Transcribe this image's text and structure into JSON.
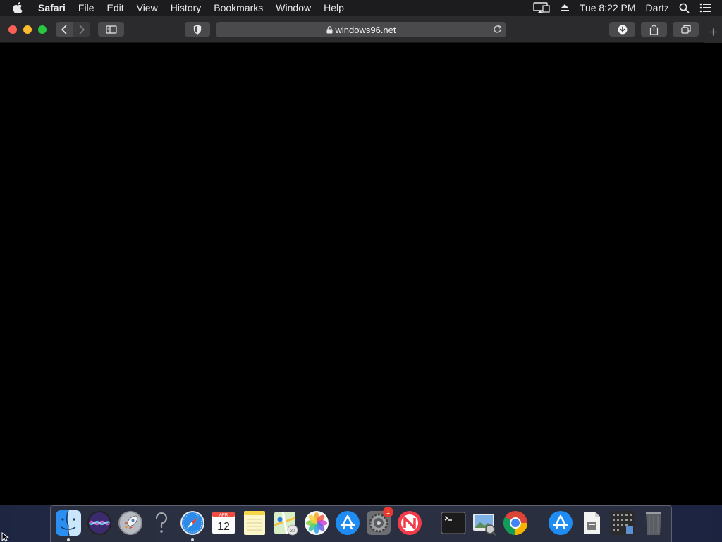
{
  "menubar": {
    "app_name": "Safari",
    "items": [
      "File",
      "Edit",
      "View",
      "History",
      "Bookmarks",
      "Window",
      "Help"
    ],
    "clock": "Tue 8:22 PM",
    "user": "Dartz"
  },
  "toolbar": {
    "url": "windows96.net"
  },
  "dock": {
    "apps": [
      "Finder",
      "Siri",
      "Launchpad",
      "Help",
      "Safari",
      "Calendar",
      "Notes",
      "Maps",
      "Photos",
      "App Store",
      "System Preferences",
      "News",
      "Terminal",
      "Preview",
      "Google Chrome",
      "App Store",
      "Document",
      "Screenshot",
      "Trash"
    ],
    "calendar_month": "APR",
    "calendar_day": "12",
    "system_preferences_badge": "1"
  },
  "colors": {
    "menubar_bg": "#1c1c1e",
    "toolbar_bg": "#2b2b2d",
    "close": "#fe5f57",
    "minimize": "#febc2e",
    "zoom": "#28c840",
    "badge": "#e93a2f"
  }
}
